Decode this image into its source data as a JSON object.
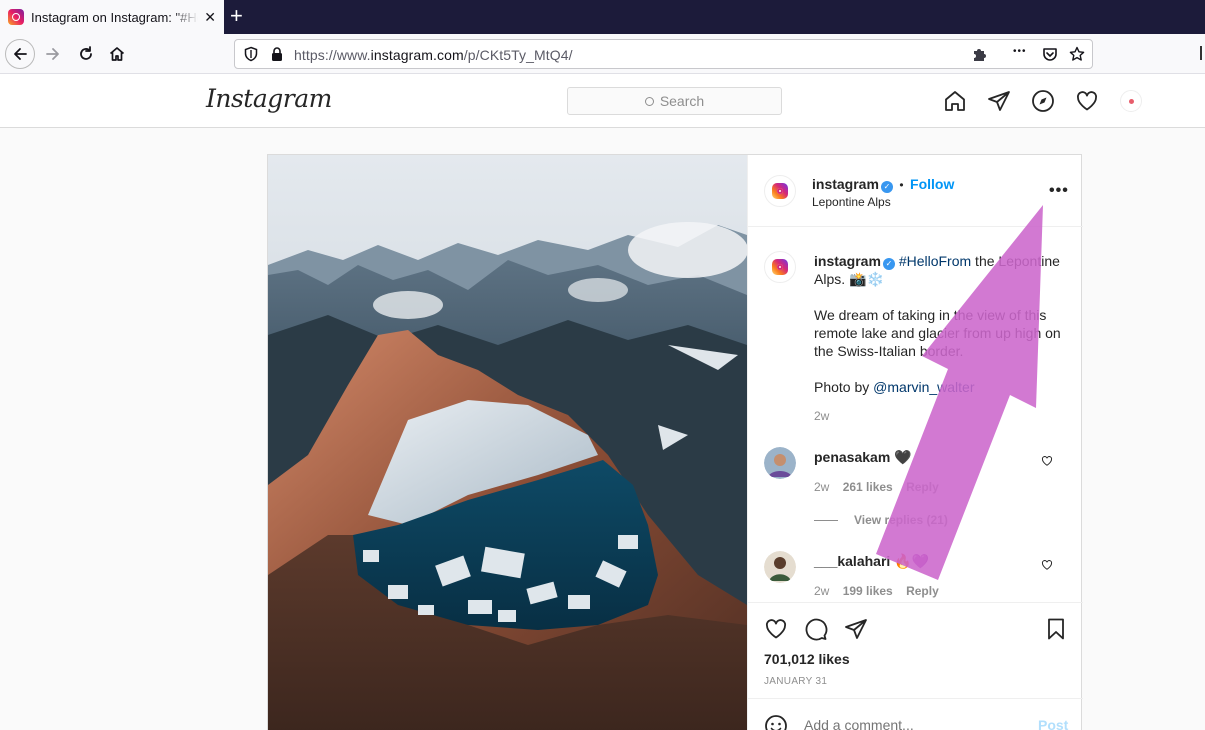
{
  "browser": {
    "tab_title": "Instagram on Instagram: \"#HelloFrom the Lepontine Alps",
    "tab_close": "✕",
    "new_tab": "+",
    "url_prefix": "https://www.",
    "url_domain": "instagram.com",
    "url_path": "/p/CKt5Ty_MtQ4/",
    "more_glyph": "•••"
  },
  "header": {
    "logo": "Instagram",
    "search_placeholder": "Search"
  },
  "post": {
    "author": "instagram",
    "follow_label": "Follow",
    "separator": "•",
    "location": "Lepontine Alps",
    "options": "•••",
    "caption": {
      "author": "instagram",
      "hashtag": "#HelloFrom",
      "line1_rest": " the Lepontine Alps. 📸❄️",
      "paragraph2": "We dream of taking in the view of this remote lake and glacier from up high on the Swiss-Italian border.",
      "photo_by": "Photo by ",
      "mention": "@marvin_walter",
      "age": "2w"
    },
    "comments": [
      {
        "user": "penasakam",
        "text": "🖤",
        "age": "2w",
        "likes": "261 likes",
        "reply": "Reply",
        "view_replies": "View replies (21)"
      },
      {
        "user": "___kalahari",
        "text": "🔥💜",
        "age": "2w",
        "likes": "199 likes",
        "reply": "Reply"
      }
    ],
    "likes": "701,012 likes",
    "date": "JANUARY 31",
    "add_comment_placeholder": "Add a comment...",
    "post_button": "Post"
  },
  "colors": {
    "link_blue": "#0095f6",
    "hashtag_blue": "#00376b",
    "annotation_arrow": "#cc66cc"
  }
}
